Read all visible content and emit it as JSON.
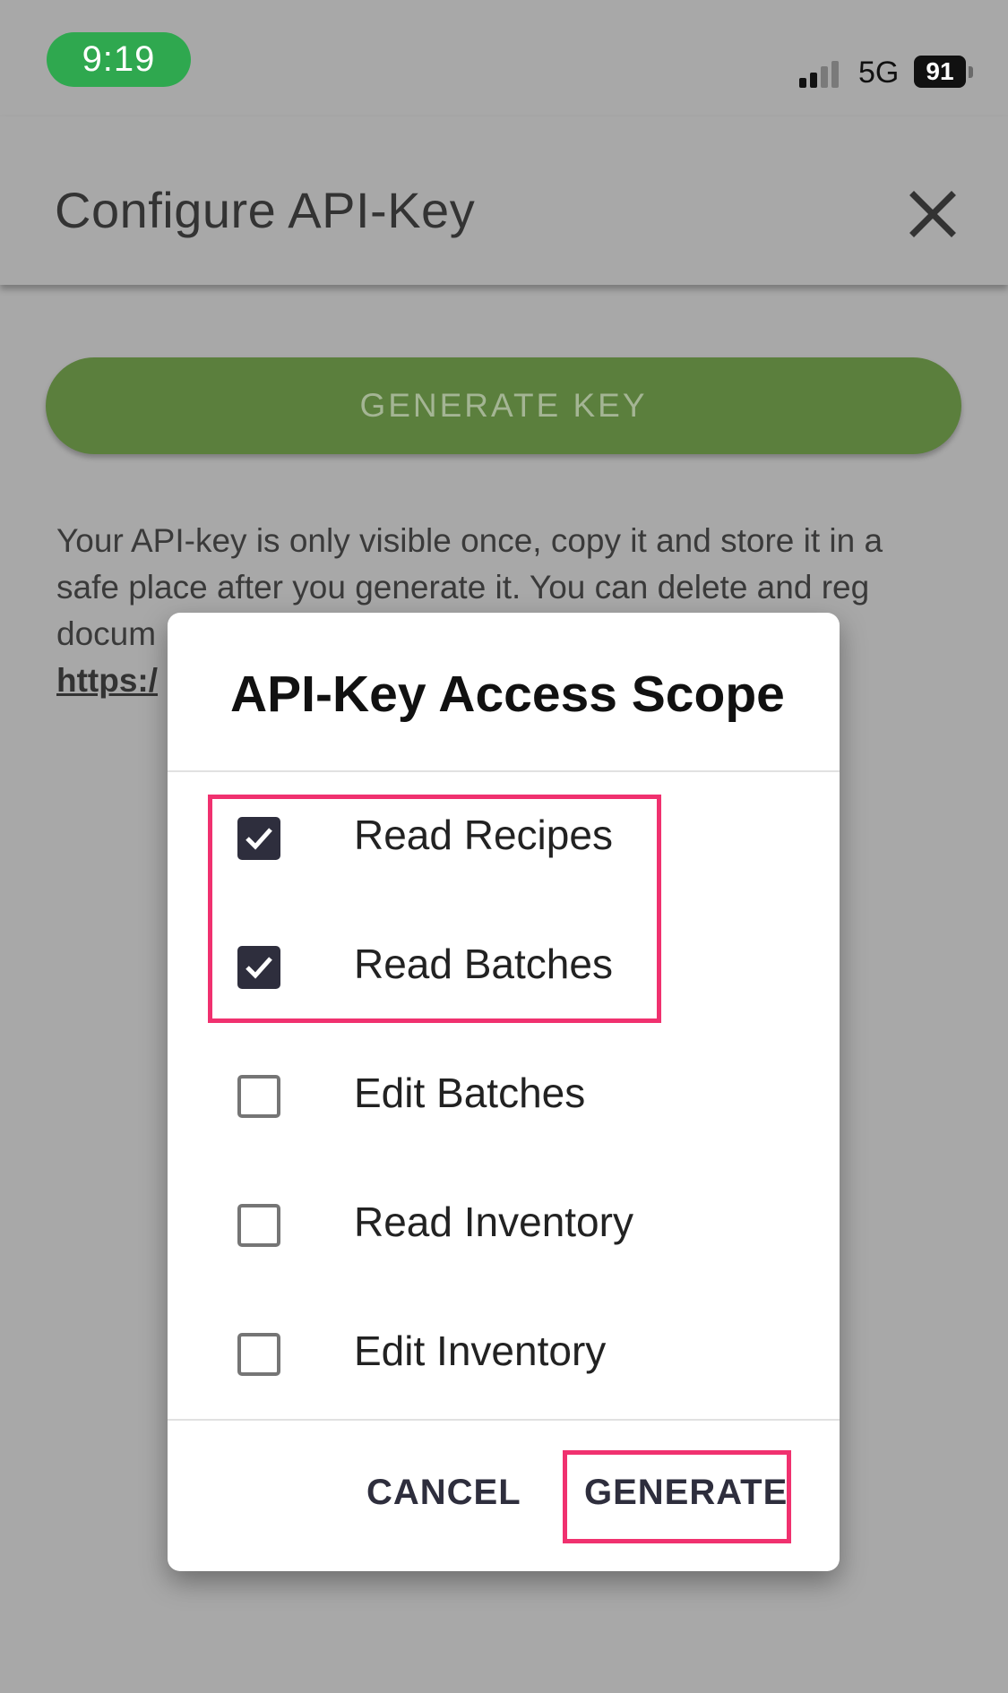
{
  "status_bar": {
    "time": "9:19",
    "network": "5G",
    "battery": "91",
    "colors": {
      "time_pill": "#2fa84f"
    }
  },
  "header": {
    "title": "Configure API-Key",
    "close_icon": "close-icon"
  },
  "main": {
    "generate_key_label": "GENERATE KEY",
    "info_text": "Your API-key is only visible once, copy it and store it in a safe place after you generate it. You can delete and reg",
    "info_text_partial_line": "docum",
    "info_link_partial": "https:/"
  },
  "dialog": {
    "title": "API-Key Access Scope",
    "scopes": [
      {
        "label": "Read Recipes",
        "checked": true
      },
      {
        "label": "Read Batches",
        "checked": true
      },
      {
        "label": "Edit Batches",
        "checked": false
      },
      {
        "label": "Read Inventory",
        "checked": false
      },
      {
        "label": "Edit Inventory",
        "checked": false
      }
    ],
    "cancel_label": "CANCEL",
    "generate_label": "GENERATE"
  },
  "colors": {
    "accent_green": "#5b7f3d",
    "checkbox_checked": "#2e2e3d",
    "highlight": "#f0316f"
  }
}
